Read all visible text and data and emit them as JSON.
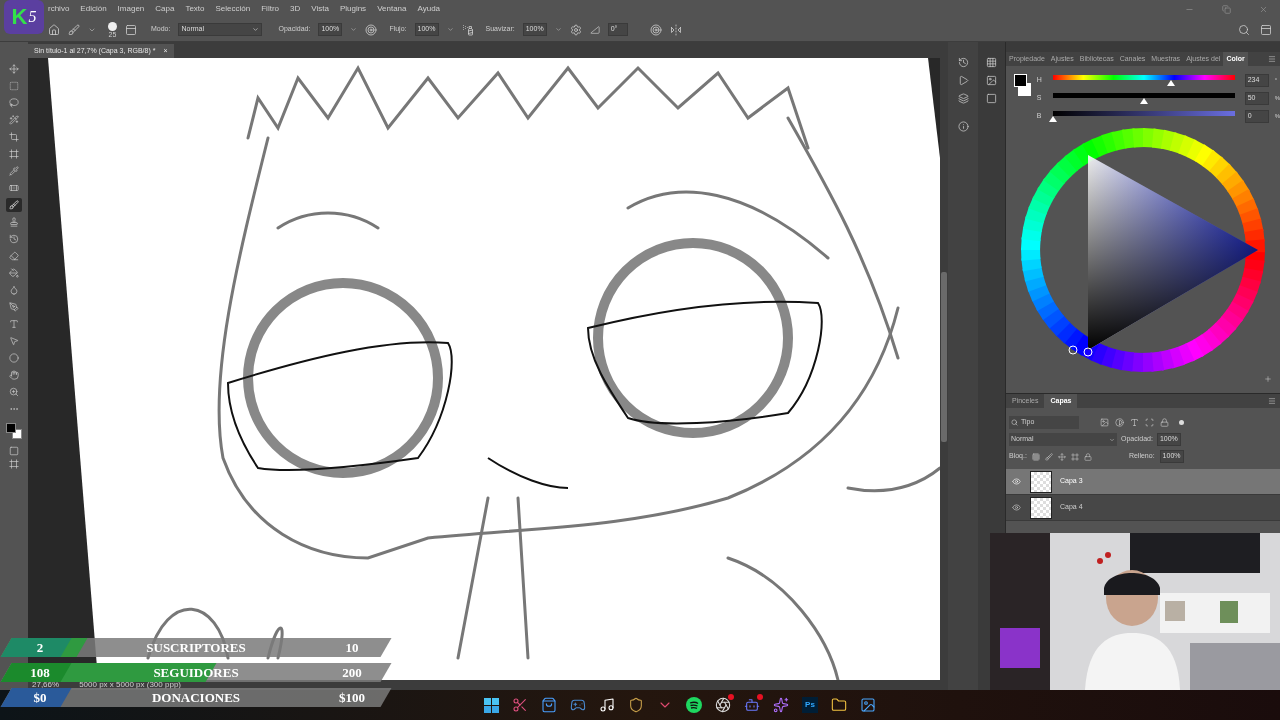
{
  "logo": {
    "letter": "K",
    "number": "5"
  },
  "menu": [
    "rchivo",
    "Edición",
    "Imagen",
    "Capa",
    "Texto",
    "Selección",
    "Filtro",
    "3D",
    "Vista",
    "Plugins",
    "Ventana",
    "Ayuda"
  ],
  "options_bar": {
    "brush_size": "25",
    "mode_label": "Modo:",
    "mode": "Normal",
    "opacity_label": "Opacidad:",
    "opacity": "100%",
    "flow_label": "Flujo:",
    "flow": "100%",
    "smoothing_label": "Suavizar:",
    "smoothing": "100%",
    "angle": "0°"
  },
  "document_tab": {
    "title": "Sin título-1 al 27,7% (Capa 3, RGB/8) *",
    "close": "×"
  },
  "tools": [
    {
      "selected": false
    },
    {
      "selected": false
    },
    {
      "selected": false
    },
    {
      "selected": false
    },
    {
      "selected": false
    },
    {
      "selected": false
    },
    {
      "selected": false
    },
    {
      "selected": false
    },
    {
      "selected": true
    },
    {
      "selected": false
    },
    {
      "selected": false
    },
    {
      "selected": false
    },
    {
      "selected": false
    },
    {
      "selected": false
    },
    {
      "selected": false
    },
    {
      "selected": false
    },
    {
      "selected": false
    },
    {
      "selected": false
    },
    {
      "selected": false
    },
    {
      "selected": false
    },
    {
      "selected": false
    }
  ],
  "panel_tabs": [
    {
      "label": "Propiedade",
      "selected": false
    },
    {
      "label": "Ajustes",
      "selected": false
    },
    {
      "label": "Bibliotecas",
      "selected": false
    },
    {
      "label": "Canales",
      "selected": false
    },
    {
      "label": "Muestras",
      "selected": false
    },
    {
      "label": "Ajustes del",
      "selected": false
    },
    {
      "label": "Color",
      "selected": true
    }
  ],
  "color_sliders": [
    {
      "kind": "hue",
      "label": "H",
      "value": "234",
      "unit": "°",
      "level": 0.65
    },
    {
      "kind": "saturation",
      "label": "S",
      "value": "50",
      "unit": "%",
      "level": 0.5
    },
    {
      "kind": "brightness",
      "label": "B",
      "value": "0",
      "unit": "%",
      "level": 0
    }
  ],
  "layers_panel": {
    "tabs": [
      {
        "label": "Pinceles",
        "selected": false
      },
      {
        "label": "Capas",
        "selected": true
      }
    ],
    "filter": "Tipo",
    "blend_mode": "Normal",
    "opacity_label": "Opacidad:",
    "opacity": "100%",
    "lock_label": "Bloq.:",
    "fill_label": "Relleno:",
    "fill": "100%",
    "layers": [
      {
        "name": "Capa 3",
        "visible": true,
        "selected": true
      },
      {
        "name": "Capa 4",
        "visible": true,
        "selected": false
      }
    ]
  },
  "status_bar": {
    "zoom": "27,66%",
    "size": "5000 px x 5000 px (300 ppp)"
  },
  "stream_goals": [
    {
      "current": "2",
      "label": "SUSCRIPTORES",
      "target": "10",
      "level": 0.2,
      "color": "#1e8a66"
    },
    {
      "current": "108",
      "label": "SEGUIDORES",
      "target": "200",
      "level": 0.54,
      "color": "#1b8a2c"
    },
    {
      "current": "$0",
      "label": "DONACIONES",
      "target": "$100",
      "level": 0,
      "color": "#2a5a9a"
    }
  ],
  "taskbar": {
    "app_label": "Ps"
  }
}
